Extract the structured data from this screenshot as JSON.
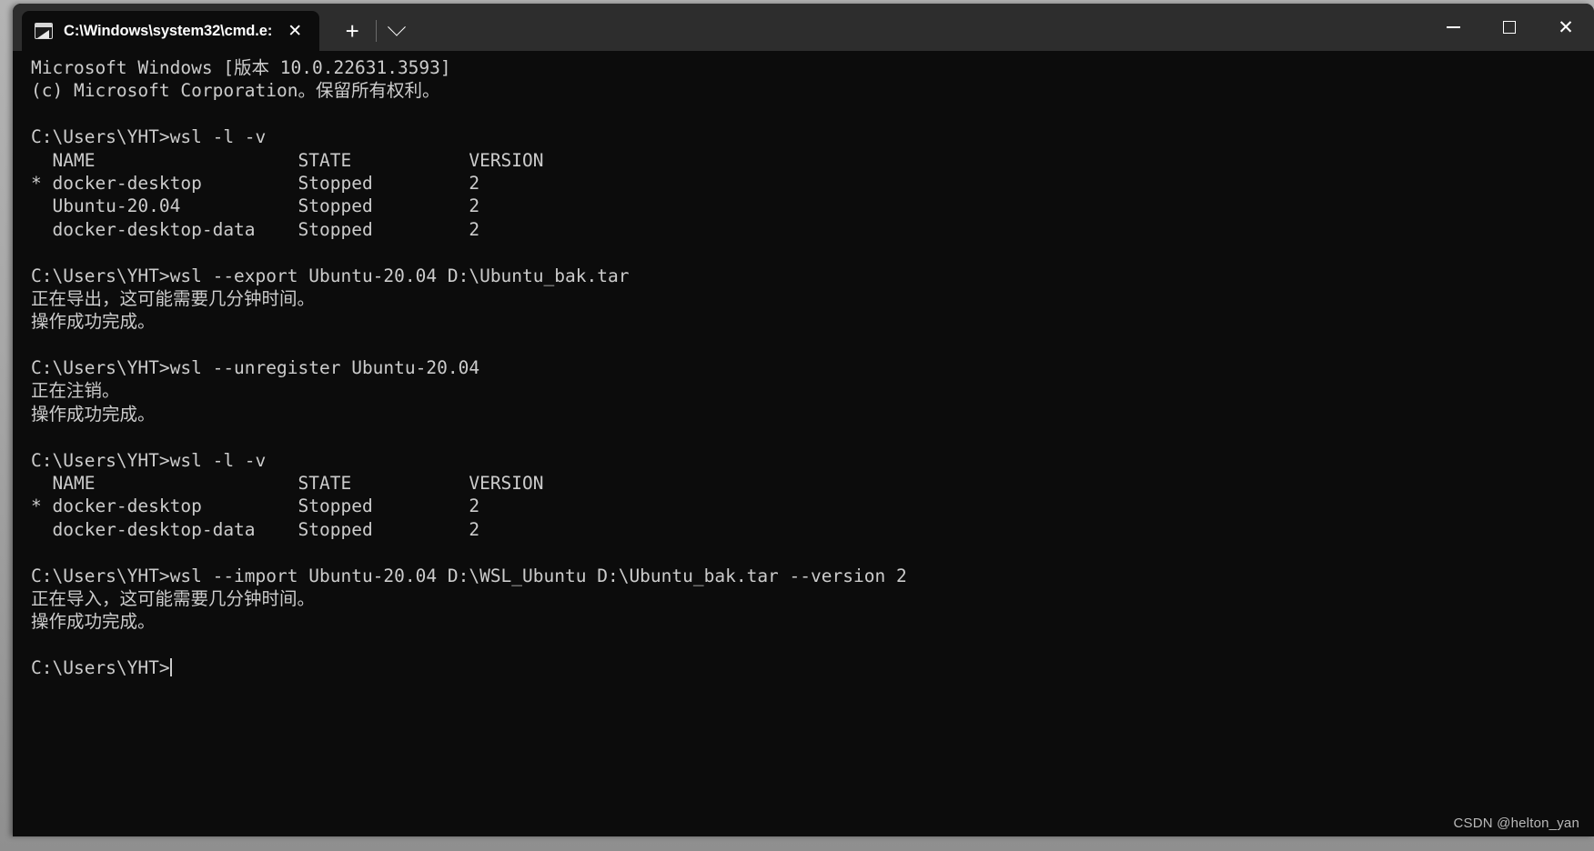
{
  "window": {
    "tab": {
      "title": "C:\\Windows\\system32\\cmd.e:",
      "icon": "console-icon",
      "close_label": "✕"
    },
    "new_tab_label": "+",
    "dropdown_label": "⌄",
    "controls": {
      "minimize_label": "—",
      "maximize_label": "□",
      "close_label": "✕"
    },
    "colors": {
      "titlebar_bg": "#2d2d2d",
      "terminal_bg": "#0c0c0c",
      "terminal_fg": "#cccccc",
      "close_hover": "#c42b1c"
    }
  },
  "terminal": {
    "lines": [
      "Microsoft Windows [版本 10.0.22631.3593]",
      "(c) Microsoft Corporation。保留所有权利。",
      "",
      "C:\\Users\\YHT>wsl -l -v",
      "  NAME                   STATE           VERSION",
      "* docker-desktop         Stopped         2",
      "  Ubuntu-20.04           Stopped         2",
      "  docker-desktop-data    Stopped         2",
      "",
      "C:\\Users\\YHT>wsl --export Ubuntu-20.04 D:\\Ubuntu_bak.tar",
      "正在导出，这可能需要几分钟时间。",
      "操作成功完成。",
      "",
      "C:\\Users\\YHT>wsl --unregister Ubuntu-20.04",
      "正在注销。",
      "操作成功完成。",
      "",
      "C:\\Users\\YHT>wsl -l -v",
      "  NAME                   STATE           VERSION",
      "* docker-desktop         Stopped         2",
      "  docker-desktop-data    Stopped         2",
      "",
      "C:\\Users\\YHT>wsl --import Ubuntu-20.04 D:\\WSL_Ubuntu D:\\Ubuntu_bak.tar --version 2",
      "正在导入，这可能需要几分钟时间。",
      "操作成功完成。",
      "",
      "C:\\Users\\YHT>"
    ],
    "prompt": "C:\\Users\\YHT>",
    "wsl_listings": [
      {
        "headers": [
          "NAME",
          "STATE",
          "VERSION"
        ],
        "rows": [
          {
            "default": "*",
            "name": "docker-desktop",
            "state": "Stopped",
            "version": "2"
          },
          {
            "default": " ",
            "name": "Ubuntu-20.04",
            "state": "Stopped",
            "version": "2"
          },
          {
            "default": " ",
            "name": "docker-desktop-data",
            "state": "Stopped",
            "version": "2"
          }
        ]
      },
      {
        "headers": [
          "NAME",
          "STATE",
          "VERSION"
        ],
        "rows": [
          {
            "default": "*",
            "name": "docker-desktop",
            "state": "Stopped",
            "version": "2"
          },
          {
            "default": " ",
            "name": "docker-desktop-data",
            "state": "Stopped",
            "version": "2"
          }
        ]
      }
    ]
  },
  "watermark": {
    "text": "CSDN @helton_yan"
  }
}
